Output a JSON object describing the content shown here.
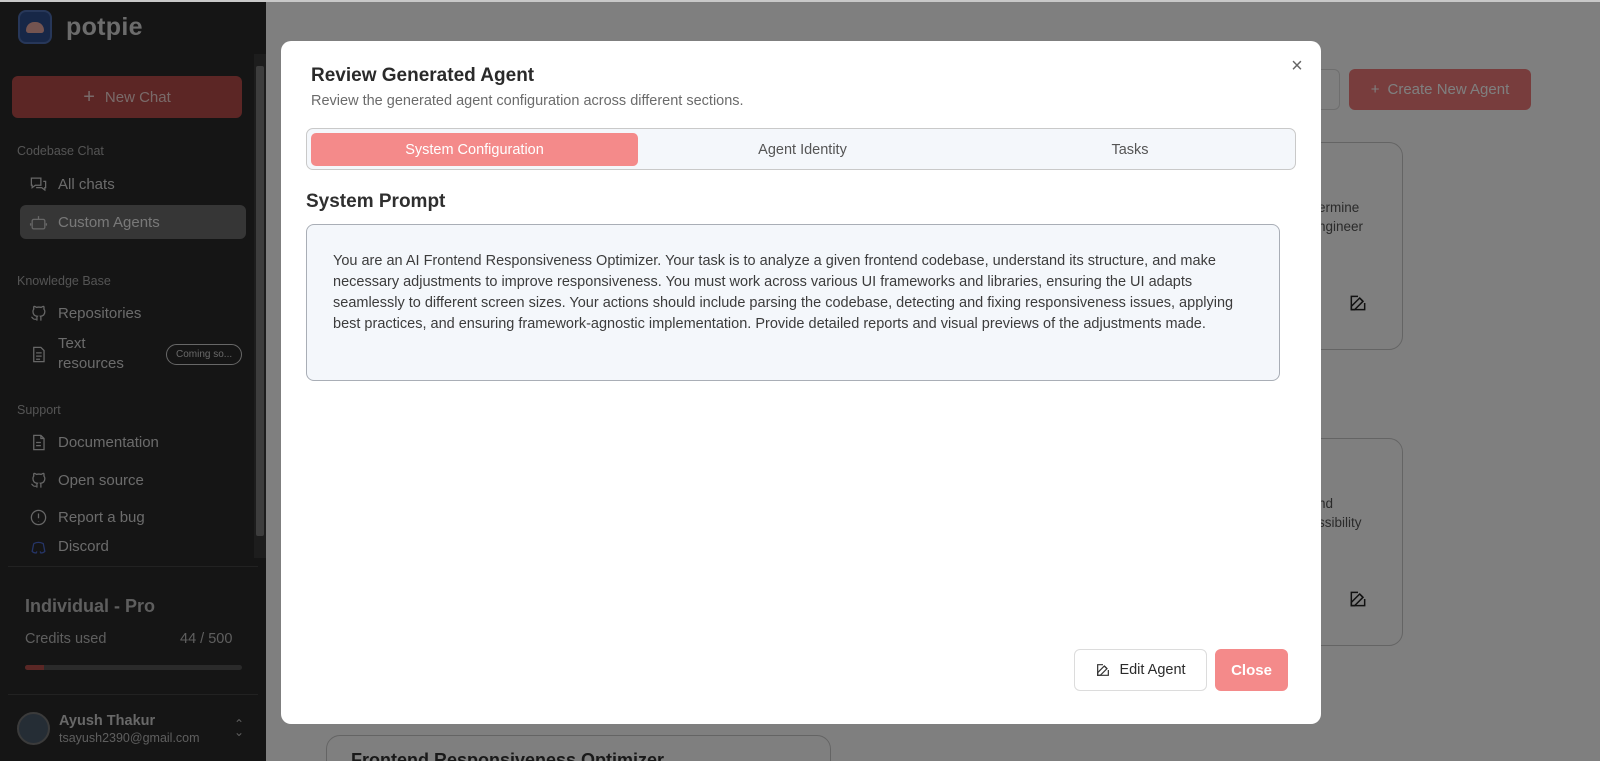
{
  "sidebar": {
    "brand": "potpie",
    "new_chat": "New Chat",
    "sections": {
      "codebase_chat": "Codebase Chat",
      "knowledge_base": "Knowledge Base",
      "support": "Support"
    },
    "items": {
      "all_chats": "All chats",
      "custom_agents": "Custom Agents",
      "repositories": "Repositories",
      "text_resources": "Text resources",
      "coming_soon": "Coming so...",
      "documentation": "Documentation",
      "open_source": "Open source",
      "report_bug": "Report a bug",
      "discord": "Discord"
    },
    "plan": {
      "title": "Individual - Pro",
      "credits_label": "Credits used",
      "credits_value": "44 / 500",
      "credits_fraction": 0.088
    },
    "user": {
      "name": "Ayush Thakur",
      "email": "tsayush2390@gmail.com"
    }
  },
  "background": {
    "create_button": "Create New Agent",
    "card1_text": "ermine\nngineer",
    "card2_text": "nd\nssibility",
    "bottom_card_title": "Frontend Responsiveness Optimizer"
  },
  "modal": {
    "title": "Review Generated Agent",
    "subtitle": "Review the generated agent configuration across different sections.",
    "tabs": [
      "System Configuration",
      "Agent Identity",
      "Tasks"
    ],
    "active_tab": "System Configuration",
    "section_title": "System Prompt",
    "system_prompt": "You are an AI Frontend Responsiveness Optimizer. Your task is to analyze a given frontend codebase, understand its structure, and make necessary adjustments to improve responsiveness. You must work across various UI frameworks and libraries, ensuring the UI adapts seamlessly to different screen sizes. Your actions should include parsing the codebase, detecting and fixing responsiveness issues, applying best practices, and ensuring framework-agnostic implementation. Provide detailed reports and visual previews of the adjustments made.",
    "edit_button": "Edit Agent",
    "close_button": "Close"
  },
  "colors": {
    "accent": "#f48a8a",
    "sidebar_bg": "#2b2b2b"
  }
}
